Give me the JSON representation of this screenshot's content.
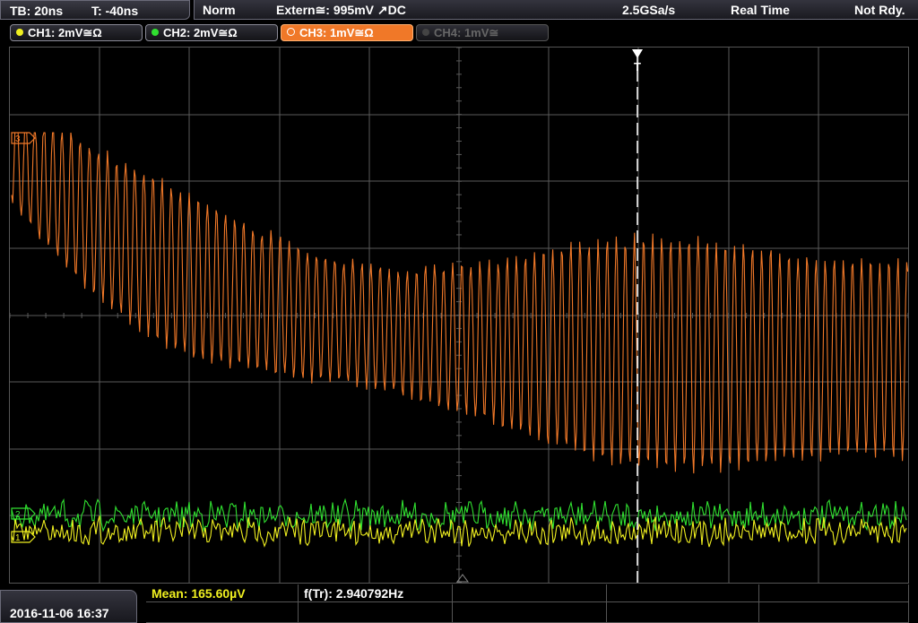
{
  "topbar": {
    "timebase": "TB: 20ns",
    "trigger_time": "T: -40ns"
  },
  "status": {
    "mode": "Norm",
    "trigger": "Extern≅: 995mV ↗DC",
    "sample_rate": "2.5GSa/s",
    "acq_mode": "Real Time",
    "state": "Not Rdy."
  },
  "channels": [
    {
      "label": "CH1: 2mV≅Ω",
      "color": "#f0f020",
      "state": "on"
    },
    {
      "label": "CH2: 2mV≅Ω",
      "color": "#30e030",
      "state": "on"
    },
    {
      "label": "CH3: 1mV≅Ω",
      "color": "#f07828",
      "state": "active"
    },
    {
      "label": "CH4: 1mV≅",
      "color": "#555555",
      "state": "off"
    }
  ],
  "markers": {
    "ch3_marker": "3",
    "ch2_marker": "2",
    "ch1_marker": "1",
    "trigger_marker": "T"
  },
  "measurements": {
    "mean": "Mean: 165.60µV",
    "freq": "f(Tr): 2.940792Hz"
  },
  "datetime": "2016-11-06 16:37",
  "colors": {
    "ch1": "#f0f020",
    "ch2": "#30e030",
    "ch3": "#f07828",
    "grid": "#5a5a5a",
    "trigger": "#ffffff"
  }
}
